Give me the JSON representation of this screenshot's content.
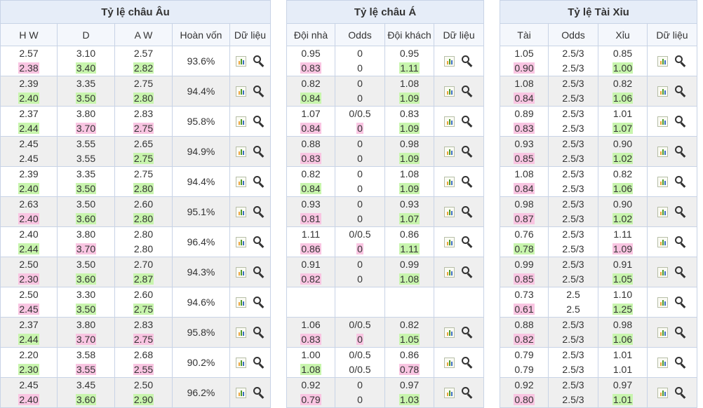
{
  "eu": {
    "title": "Tỷ lệ châu Âu",
    "headers": [
      "H W",
      "D",
      "A W",
      "Hoàn vốn",
      "Dữ liệu"
    ],
    "rows": [
      {
        "hw": [
          "2.57",
          "2.38"
        ],
        "d": [
          "3.10",
          "3.40"
        ],
        "aw": [
          "2.57",
          "2.82"
        ],
        "hs": [
          "",
          "dn"
        ],
        "ds": [
          "",
          "up"
        ],
        "as": [
          "",
          "up"
        ],
        "ret": "93.6%"
      },
      {
        "hw": [
          "2.39",
          "2.40"
        ],
        "d": [
          "3.35",
          "3.50"
        ],
        "aw": [
          "2.75",
          "2.80"
        ],
        "hs": [
          "",
          "up"
        ],
        "ds": [
          "",
          "up"
        ],
        "as": [
          "",
          "up"
        ],
        "ret": "94.4%"
      },
      {
        "hw": [
          "2.37",
          "2.44"
        ],
        "d": [
          "3.80",
          "3.70"
        ],
        "aw": [
          "2.83",
          "2.75"
        ],
        "hs": [
          "",
          "up"
        ],
        "ds": [
          "",
          "dn"
        ],
        "as": [
          "",
          "dn"
        ],
        "ret": "95.8%"
      },
      {
        "hw": [
          "2.45",
          "2.45"
        ],
        "d": [
          "3.55",
          "3.55"
        ],
        "aw": [
          "2.65",
          "2.75"
        ],
        "hs": [
          "",
          ""
        ],
        "ds": [
          "",
          ""
        ],
        "as": [
          "",
          "up"
        ],
        "ret": "94.9%"
      },
      {
        "hw": [
          "2.39",
          "2.40"
        ],
        "d": [
          "3.35",
          "3.50"
        ],
        "aw": [
          "2.75",
          "2.80"
        ],
        "hs": [
          "",
          "up"
        ],
        "ds": [
          "",
          "up"
        ],
        "as": [
          "",
          "up"
        ],
        "ret": "94.4%"
      },
      {
        "hw": [
          "2.63",
          "2.40"
        ],
        "d": [
          "3.50",
          "3.60"
        ],
        "aw": [
          "2.60",
          "2.80"
        ],
        "hs": [
          "",
          "dn"
        ],
        "ds": [
          "",
          "up"
        ],
        "as": [
          "",
          "up"
        ],
        "ret": "95.1%"
      },
      {
        "hw": [
          "2.40",
          "2.44"
        ],
        "d": [
          "3.80",
          "3.70"
        ],
        "aw": [
          "2.80",
          "2.80"
        ],
        "hs": [
          "",
          "up"
        ],
        "ds": [
          "",
          "dn"
        ],
        "as": [
          "",
          ""
        ],
        "ret": "96.4%"
      },
      {
        "hw": [
          "2.50",
          "2.30"
        ],
        "d": [
          "3.50",
          "3.60"
        ],
        "aw": [
          "2.70",
          "2.87"
        ],
        "hs": [
          "",
          "dn"
        ],
        "ds": [
          "",
          "up"
        ],
        "as": [
          "",
          "up"
        ],
        "ret": "94.3%"
      },
      {
        "hw": [
          "2.50",
          "2.45"
        ],
        "d": [
          "3.30",
          "3.50"
        ],
        "aw": [
          "2.60",
          "2.75"
        ],
        "hs": [
          "",
          "dn"
        ],
        "ds": [
          "",
          "up"
        ],
        "as": [
          "",
          "up"
        ],
        "ret": "94.6%"
      },
      {
        "hw": [
          "2.37",
          "2.44"
        ],
        "d": [
          "3.80",
          "3.70"
        ],
        "aw": [
          "2.83",
          "2.75"
        ],
        "hs": [
          "",
          "up"
        ],
        "ds": [
          "",
          "dn"
        ],
        "as": [
          "",
          "dn"
        ],
        "ret": "95.8%"
      },
      {
        "hw": [
          "2.20",
          "2.30"
        ],
        "d": [
          "3.58",
          "3.55"
        ],
        "aw": [
          "2.68",
          "2.55"
        ],
        "hs": [
          "",
          "up"
        ],
        "ds": [
          "",
          "dn"
        ],
        "as": [
          "",
          "dn"
        ],
        "ret": "90.2%"
      },
      {
        "hw": [
          "2.45",
          "2.40"
        ],
        "d": [
          "3.45",
          "3.60"
        ],
        "aw": [
          "2.50",
          "2.90"
        ],
        "hs": [
          "",
          "dn"
        ],
        "ds": [
          "",
          "up"
        ],
        "as": [
          "",
          "up"
        ],
        "ret": "96.2%"
      }
    ]
  },
  "asia": {
    "title": "Tỷ lệ châu Á",
    "headers": [
      "Đội nhà",
      "Odds",
      "Đội khách",
      "Dữ liệu"
    ],
    "rows": [
      {
        "h": [
          "0.95",
          "0.83"
        ],
        "o": [
          "0",
          "0"
        ],
        "a": [
          "0.95",
          "1.11"
        ],
        "hs": [
          "",
          "dn"
        ],
        "os": [
          "",
          ""
        ],
        "as": [
          "",
          "up"
        ]
      },
      {
        "h": [
          "0.82",
          "0.84"
        ],
        "o": [
          "0",
          "0"
        ],
        "a": [
          "1.08",
          "1.09"
        ],
        "hs": [
          "",
          "up"
        ],
        "os": [
          "",
          ""
        ],
        "as": [
          "",
          "up"
        ]
      },
      {
        "h": [
          "1.07",
          "0.84"
        ],
        "o": [
          "0/0.5",
          "0"
        ],
        "a": [
          "0.83",
          "1.09"
        ],
        "hs": [
          "",
          "dn"
        ],
        "os": [
          "",
          "dn"
        ],
        "as": [
          "",
          "up"
        ]
      },
      {
        "h": [
          "0.88",
          "0.83"
        ],
        "o": [
          "0",
          "0"
        ],
        "a": [
          "0.98",
          "1.09"
        ],
        "hs": [
          "",
          "dn"
        ],
        "os": [
          "",
          ""
        ],
        "as": [
          "",
          "up"
        ]
      },
      {
        "h": [
          "0.82",
          "0.84"
        ],
        "o": [
          "0",
          "0"
        ],
        "a": [
          "1.08",
          "1.09"
        ],
        "hs": [
          "",
          "up"
        ],
        "os": [
          "",
          ""
        ],
        "as": [
          "",
          "up"
        ]
      },
      {
        "h": [
          "0.93",
          "0.81"
        ],
        "o": [
          "0",
          "0"
        ],
        "a": [
          "0.93",
          "1.07"
        ],
        "hs": [
          "",
          "dn"
        ],
        "os": [
          "",
          ""
        ],
        "as": [
          "",
          "up"
        ]
      },
      {
        "h": [
          "1.11",
          "0.86"
        ],
        "o": [
          "0/0.5",
          "0"
        ],
        "a": [
          "0.86",
          "1.11"
        ],
        "hs": [
          "",
          "dn"
        ],
        "os": [
          "",
          "dn"
        ],
        "as": [
          "",
          "up"
        ]
      },
      {
        "h": [
          "0.91",
          "0.82"
        ],
        "o": [
          "0",
          "0"
        ],
        "a": [
          "0.99",
          "1.08"
        ],
        "hs": [
          "",
          "dn"
        ],
        "os": [
          "",
          ""
        ],
        "as": [
          "",
          "up"
        ]
      },
      {
        "h": [
          "",
          ""
        ],
        "o": [
          "",
          ""
        ],
        "a": [
          "",
          ""
        ],
        "hs": [
          "",
          ""
        ],
        "os": [
          "",
          ""
        ],
        "as": [
          "",
          ""
        ],
        "empty": true
      },
      {
        "h": [
          "1.06",
          "0.83"
        ],
        "o": [
          "0/0.5",
          "0"
        ],
        "a": [
          "0.82",
          "1.05"
        ],
        "hs": [
          "",
          "dn"
        ],
        "os": [
          "",
          "dn"
        ],
        "as": [
          "",
          "up"
        ]
      },
      {
        "h": [
          "1.00",
          "1.08"
        ],
        "o": [
          "0/0.5",
          "0/0.5"
        ],
        "a": [
          "0.86",
          "0.78"
        ],
        "hs": [
          "",
          "up"
        ],
        "os": [
          "",
          ""
        ],
        "as": [
          "",
          "dn"
        ]
      },
      {
        "h": [
          "0.92",
          "0.79"
        ],
        "o": [
          "0",
          "0"
        ],
        "a": [
          "0.97",
          "1.03"
        ],
        "hs": [
          "",
          "dn"
        ],
        "os": [
          "",
          ""
        ],
        "as": [
          "",
          "up"
        ]
      }
    ]
  },
  "ou": {
    "title": "Tỷ lệ Tài Xỉu",
    "headers": [
      "Tài",
      "Odds",
      "Xỉu",
      "Dữ liệu"
    ],
    "rows": [
      {
        "t": [
          "1.05",
          "0.90"
        ],
        "o": [
          "2.5/3",
          "2.5/3"
        ],
        "x": [
          "0.85",
          "1.00"
        ],
        "ts": [
          "",
          "dn"
        ],
        "xs": [
          "",
          "up"
        ]
      },
      {
        "t": [
          "1.08",
          "0.84"
        ],
        "o": [
          "2.5/3",
          "2.5/3"
        ],
        "x": [
          "0.82",
          "1.06"
        ],
        "ts": [
          "",
          "dn"
        ],
        "xs": [
          "",
          "up"
        ]
      },
      {
        "t": [
          "0.89",
          "0.83"
        ],
        "o": [
          "2.5/3",
          "2.5/3"
        ],
        "x": [
          "1.01",
          "1.07"
        ],
        "ts": [
          "",
          "dn"
        ],
        "xs": [
          "",
          "up"
        ]
      },
      {
        "t": [
          "0.93",
          "0.85"
        ],
        "o": [
          "2.5/3",
          "2.5/3"
        ],
        "x": [
          "0.90",
          "1.02"
        ],
        "ts": [
          "",
          "dn"
        ],
        "xs": [
          "",
          "up"
        ]
      },
      {
        "t": [
          "1.08",
          "0.84"
        ],
        "o": [
          "2.5/3",
          "2.5/3"
        ],
        "x": [
          "0.82",
          "1.06"
        ],
        "ts": [
          "",
          "dn"
        ],
        "xs": [
          "",
          "up"
        ]
      },
      {
        "t": [
          "0.98",
          "0.87"
        ],
        "o": [
          "2.5/3",
          "2.5/3"
        ],
        "x": [
          "0.90",
          "1.02"
        ],
        "ts": [
          "",
          "dn"
        ],
        "xs": [
          "",
          "up"
        ]
      },
      {
        "t": [
          "0.76",
          "0.78"
        ],
        "o": [
          "2.5/3",
          "2.5/3"
        ],
        "x": [
          "1.11",
          "1.09"
        ],
        "ts": [
          "",
          "up"
        ],
        "xs": [
          "",
          "dn"
        ]
      },
      {
        "t": [
          "0.99",
          "0.85"
        ],
        "o": [
          "2.5/3",
          "2.5/3"
        ],
        "x": [
          "0.91",
          "1.05"
        ],
        "ts": [
          "",
          "dn"
        ],
        "xs": [
          "",
          "up"
        ]
      },
      {
        "t": [
          "0.73",
          "0.61"
        ],
        "o": [
          "2.5",
          "2.5"
        ],
        "x": [
          "1.10",
          "1.25"
        ],
        "ts": [
          "",
          "dn"
        ],
        "xs": [
          "",
          "up"
        ]
      },
      {
        "t": [
          "0.88",
          "0.82"
        ],
        "o": [
          "2.5/3",
          "2.5/3"
        ],
        "x": [
          "0.98",
          "1.06"
        ],
        "ts": [
          "",
          "dn"
        ],
        "xs": [
          "",
          "up"
        ]
      },
      {
        "t": [
          "0.79",
          "0.79"
        ],
        "o": [
          "2.5/3",
          "2.5/3"
        ],
        "x": [
          "1.01",
          "1.01"
        ],
        "ts": [
          "",
          ""
        ],
        "xs": [
          "",
          ""
        ]
      },
      {
        "t": [
          "0.92",
          "0.80"
        ],
        "o": [
          "2.5/3",
          "2.5/3"
        ],
        "x": [
          "0.97",
          "1.01"
        ],
        "ts": [
          "",
          "dn"
        ],
        "xs": [
          "",
          "up"
        ]
      }
    ]
  },
  "colors": {
    "up": "#c8f5ad",
    "down": "#f9c5e2",
    "header": "#e6edf8",
    "stripe": "#efefef"
  },
  "icons": {
    "data_chart": "bar-chart-icon",
    "data_search": "magnifier-icon"
  }
}
